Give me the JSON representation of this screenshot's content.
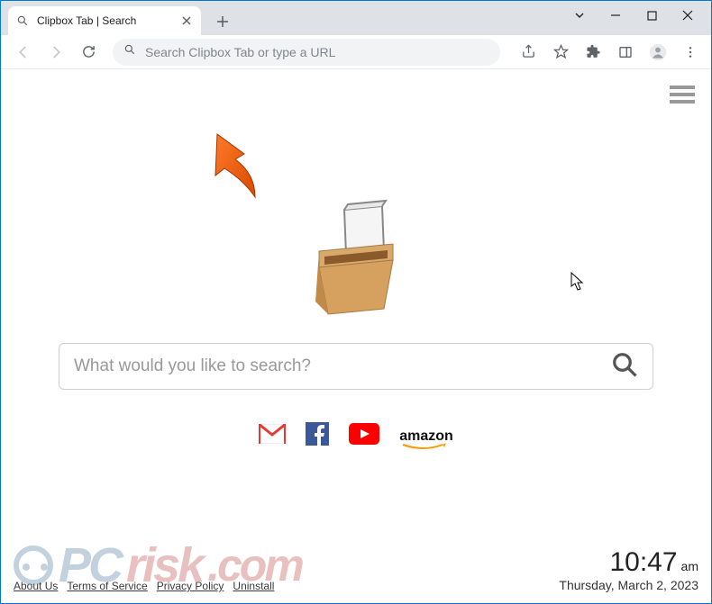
{
  "tab": {
    "title": "Clipbox Tab | Search"
  },
  "omnibox": {
    "placeholder": "Search Clipbox Tab or type a URL"
  },
  "search": {
    "placeholder": "What would you like to search?"
  },
  "quicklinks": {
    "amazon_label": "amazon"
  },
  "footer": {
    "links": [
      "About Us",
      "Terms of Service",
      "Privacy Policy",
      "Uninstall"
    ]
  },
  "clock": {
    "time": "10:47",
    "ampm": "am",
    "date": "Thursday, March 2, 2023"
  },
  "watermark": {
    "pc": "PC",
    "risk": "risk",
    "com": ".com"
  }
}
